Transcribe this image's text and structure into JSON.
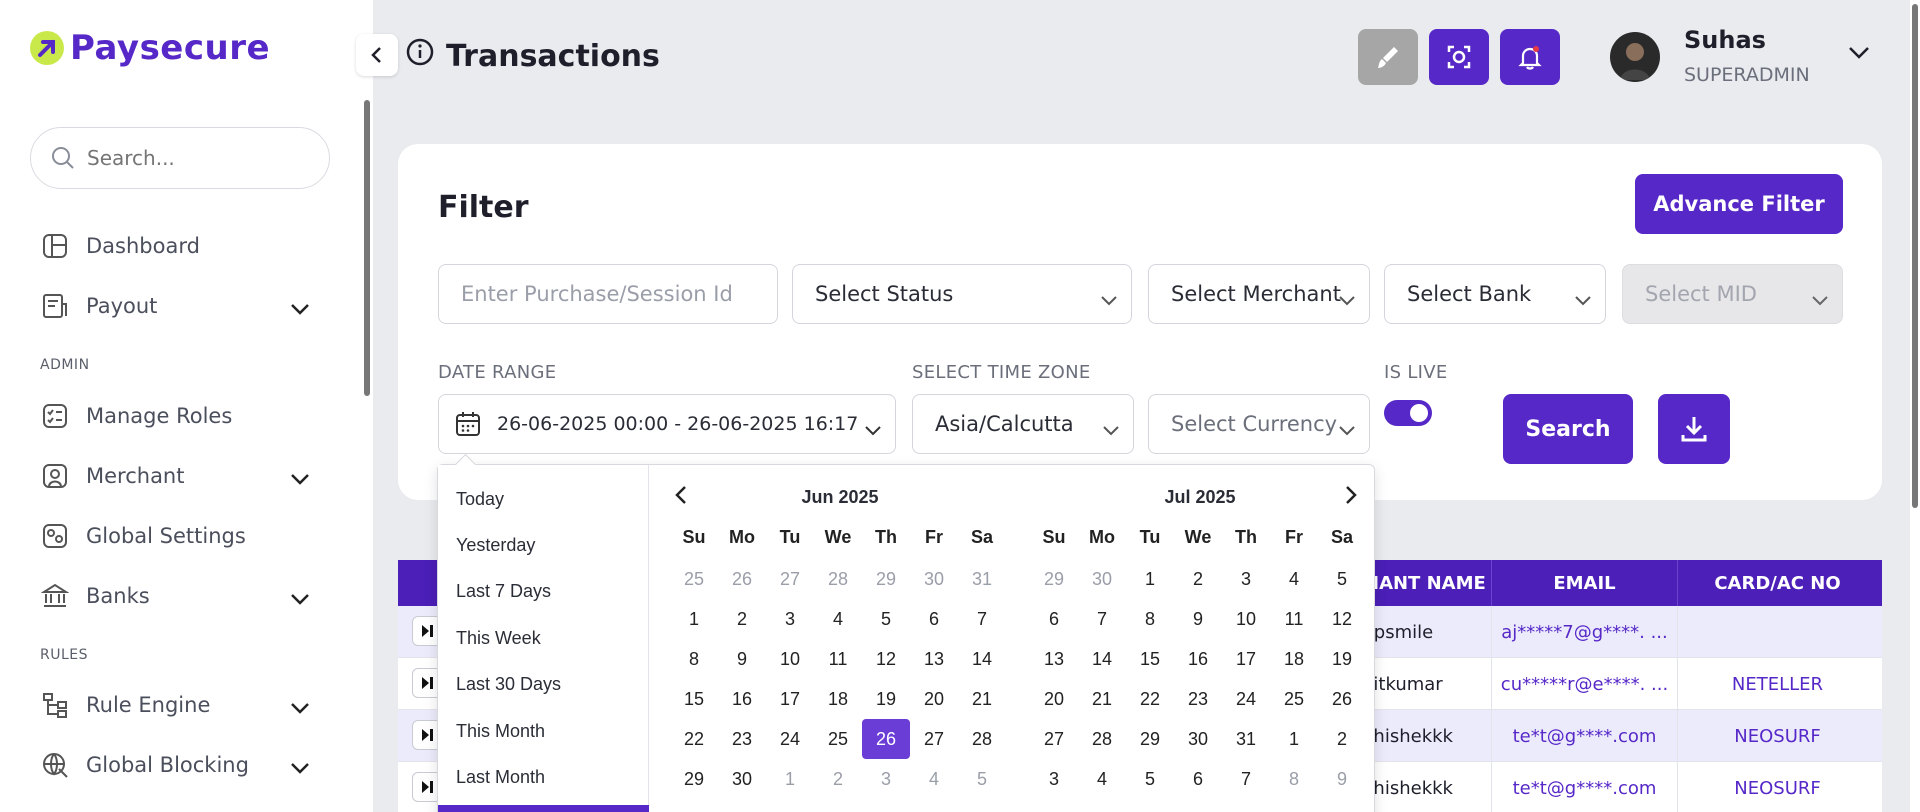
{
  "brand": {
    "name": "Paysecure"
  },
  "sidebar": {
    "search_placeholder": "Search...",
    "items": [
      {
        "label": "Dashboard",
        "icon": "dashboard-icon",
        "has_chevron": false
      },
      {
        "label": "Payout",
        "icon": "payout-icon",
        "has_chevron": true
      },
      {
        "label": "Manage Roles",
        "icon": "roles-icon",
        "has_chevron": false
      },
      {
        "label": "Merchant",
        "icon": "merchant-icon",
        "has_chevron": true
      },
      {
        "label": "Global Settings",
        "icon": "settings-icon",
        "has_chevron": false
      },
      {
        "label": "Banks",
        "icon": "bank-icon",
        "has_chevron": true
      },
      {
        "label": "Rule Engine",
        "icon": "rule-engine-icon",
        "has_chevron": true
      },
      {
        "label": "Global Blocking",
        "icon": "globe-block-icon",
        "has_chevron": true
      }
    ],
    "sections": [
      "ADMIN",
      "RULES"
    ]
  },
  "header": {
    "title": "Transactions",
    "user": {
      "name": "Suhas",
      "role": "SUPERADMIN"
    }
  },
  "filter": {
    "title": "Filter",
    "advance_label": "Advance Filter",
    "purchase_placeholder": "Enter Purchase/Session Id",
    "status": "Select Status",
    "merchant": "Select Merchant",
    "bank": "Select Bank",
    "mid": "Select MID",
    "date_range_label": "DATE RANGE",
    "date_range_value": "26-06-2025 00:00 - 26-06-2025 16:17",
    "timezone_label": "SELECT TIME ZONE",
    "timezone_value": "Asia/Calcutta",
    "currency": "Select Currency",
    "is_live_label": "IS LIVE",
    "is_live": true,
    "search_label": "Search"
  },
  "table": {
    "columns": [
      "HANT NAME",
      "EMAIL",
      "CARD/AC NO"
    ],
    "rows": [
      {
        "merchant": "Kpsmile",
        "email": "aj*****7@g****. ...",
        "card": ""
      },
      {
        "merchant": "nitkumar",
        "email": "cu*****r@e****. ...",
        "card": "NETELLER"
      },
      {
        "merchant": "bhishekkk",
        "email": "te*t@g****.com",
        "card": "NEOSURF"
      },
      {
        "merchant": "bhishekkk",
        "email": "te*t@g****.com",
        "card": "NEOSURF"
      }
    ]
  },
  "datepicker": {
    "ranges": [
      "Today",
      "Yesterday",
      "Last 7 Days",
      "This Week",
      "Last 30 Days",
      "This Month",
      "Last Month"
    ],
    "weekdays": [
      "Su",
      "Mo",
      "Tu",
      "We",
      "Th",
      "Fr",
      "Sa"
    ],
    "left_month": {
      "title": "Jun 2025",
      "days": [
        [
          "25",
          "26",
          "27",
          "28",
          "29",
          "30",
          "31"
        ],
        [
          "1",
          "2",
          "3",
          "4",
          "5",
          "6",
          "7"
        ],
        [
          "8",
          "9",
          "10",
          "11",
          "12",
          "13",
          "14"
        ],
        [
          "15",
          "16",
          "17",
          "18",
          "19",
          "20",
          "21"
        ],
        [
          "22",
          "23",
          "24",
          "25",
          "26",
          "27",
          "28"
        ],
        [
          "29",
          "30",
          "1",
          "2",
          "3",
          "4",
          "5"
        ]
      ],
      "off_first_row": 7,
      "off_last_row_from": 2,
      "selected": "26"
    },
    "right_month": {
      "title": "Jul 2025",
      "days": [
        [
          "29",
          "30",
          "1",
          "2",
          "3",
          "4",
          "5"
        ],
        [
          "6",
          "7",
          "8",
          "9",
          "10",
          "11",
          "12"
        ],
        [
          "13",
          "14",
          "15",
          "16",
          "17",
          "18",
          "19"
        ],
        [
          "20",
          "21",
          "22",
          "23",
          "24",
          "25",
          "26"
        ],
        [
          "27",
          "28",
          "29",
          "30",
          "31",
          "1",
          "2"
        ],
        [
          "3",
          "4",
          "5",
          "6",
          "7",
          "8",
          "9"
        ]
      ],
      "off_first_row": 2,
      "off_last_row_from": 5
    }
  },
  "colors": {
    "accent": "#5628c8",
    "logo_mark": "#c9e94b",
    "header_btn_gray": "#a6a6a6"
  }
}
